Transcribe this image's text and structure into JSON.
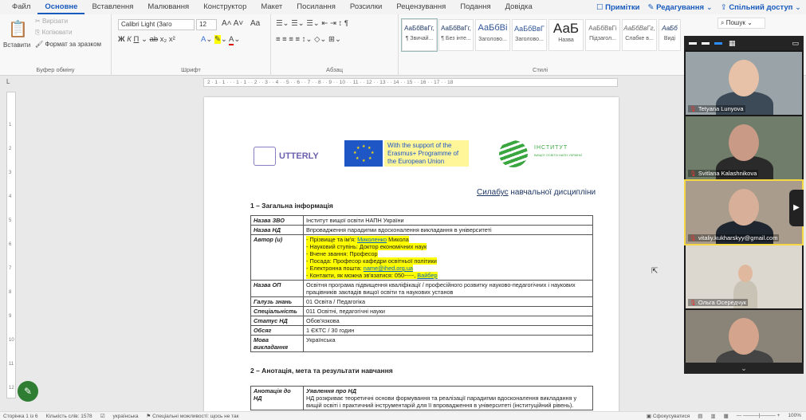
{
  "menu": {
    "items": [
      "Файл",
      "Основне",
      "Вставлення",
      "Малювання",
      "Конструктор",
      "Макет",
      "Посилання",
      "Розсилки",
      "Рецензування",
      "Подання",
      "Довідка"
    ],
    "active": "Основне",
    "right": {
      "comments": "Примітки",
      "editing": "Редагування",
      "share": "Спільний доступ"
    }
  },
  "ribbon": {
    "clipboard": {
      "paste": "Вставити",
      "cut": "Вирізати",
      "copy": "Копіювати",
      "format": "Формат за зразком",
      "label": "Буфер обміну"
    },
    "font": {
      "name": "Calibri Light (Заго",
      "size": "12",
      "label": "Шрифт"
    },
    "paragraph": {
      "label": "Абзац"
    },
    "styles": {
      "label": "Стилі",
      "items": [
        {
          "sample": "АаБбВвГг,",
          "name": "¶ Звичай..."
        },
        {
          "sample": "АаБбВвГг,",
          "name": "¶ Без інте..."
        },
        {
          "sample": "АаБбВі",
          "name": "Заголово..."
        },
        {
          "sample": "АаБбВвГ",
          "name": "Заголово..."
        },
        {
          "sample": "АаБ",
          "name": "Назва"
        },
        {
          "sample": "АаБбВвГі",
          "name": "Підзагол..."
        },
        {
          "sample": "АаБбВвГг,",
          "name": "Слабке в..."
        },
        {
          "sample": "АаБб",
          "name": "Виді"
        }
      ]
    },
    "search": "Пошук"
  },
  "ruler_top": "2 · 1 · 1 · · · 1 · 1 · · 2 · · 3 · · 4 · · 5 · · 6 · · 7 · · 8 · · 9 · · 10 · · 11 · · 12 · · 13 · · 14 · · 15 · · 16 · · 17 · · 18",
  "doc": {
    "logo_utterly": "UTTERLY",
    "eu_text": "With the support of the Erasmus+ Programme of the European Union",
    "inst_line1": "ІНСТИТУТ",
    "inst_line2": "ВИЩОЇ ОСВІТИ НАПН УКРАЇНИ",
    "syllabus_word": "Силабус",
    "syllabus_rest": " навчальної дисципліни",
    "section1": "1 – Загальна інформація",
    "rows": [
      {
        "k": "Назва ЗВО",
        "v": "Інститут вищої освіти НАПН України"
      },
      {
        "k": "Назва НД",
        "v": "Впровадження парадигми вдосконалення викладання в університеті"
      },
      {
        "k": "Назва ОП",
        "v": "Освітня програма підвищення кваліфікації / професійного розвитку науково-педагогічних і наукових працівників закладів вищої освіти та наукових установ"
      },
      {
        "k": "Галузь знань",
        "v": "01 Освіта / Педагогіка"
      },
      {
        "k": "Спеціальність",
        "v": "011 Освітні, педагогічні науки"
      },
      {
        "k": "Статус НД",
        "v": "Обов'язкова"
      },
      {
        "k": "Обсяг",
        "v": "1 ЄКТС / 30 годин"
      },
      {
        "k": "Мова викладання",
        "v": "Українська"
      }
    ],
    "author_key": "Автор (и)",
    "author_lines": [
      "Прізвище та ім'я: Миколенко Микола",
      "Науковий ступінь: Доктор економічних наук",
      "Вчене звання: Професор",
      "Посада: Професор кафедри освітньої політики",
      "Електронна пошта: name@ihed.org.ua",
      "Контакти, як можна зв'язатися: 050-----, Вайбер"
    ],
    "section2": "2 – Анотація, мета та результати навчання",
    "annot_key": "Анотація до НД",
    "annot_title": "Уявлення про НД",
    "annot_text": "НД розкриває теоретичні основи формування та реалізації парадигми вдосконалення викладання у вищій освіті і практичний інструментарій для її впровадження в університеті (інституційний рівень)."
  },
  "zoom": {
    "participants": [
      {
        "name": "Tetyana Lunyova",
        "bg": "#9aa3a8",
        "skin": "#e8c2a8",
        "cloth": "#3c4a57"
      },
      {
        "name": "Svitlana Kalashnikova",
        "bg": "#6f7d6a",
        "skin": "#c99a86",
        "cloth": "#2a2a2a"
      },
      {
        "name": "vitaliy.kukharskyy@gmail.com",
        "bg": "#a99c8c",
        "skin": "#d8b09a",
        "cloth": "#1f2630"
      },
      {
        "name": "Ольга Осередчук",
        "bg": "#ddd8cf",
        "skin": "#e0b89e",
        "cloth": "#c9c3b5"
      },
      {
        "name": "",
        "bg": "#8a8478",
        "skin": "#d4a58c",
        "cloth": "#444"
      }
    ],
    "more": "⌄"
  },
  "status": {
    "page": "Сторінка 1 із 6",
    "words": "Кількість слів: 1578",
    "lang": "українська",
    "access": "Спеціальні можливості: щось не так",
    "focus": "Сфокусуватися",
    "zoom": "100%"
  },
  "colors": {
    "accent": "#185abd",
    "highlight": "#ffff00",
    "zoom_active": "#f5d742"
  }
}
